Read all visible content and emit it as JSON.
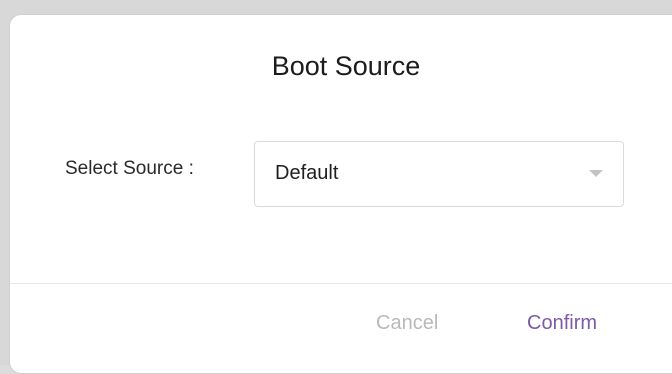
{
  "dialog": {
    "title": "Boot Source",
    "field_label": "Select Source :",
    "select": {
      "selected_value": "Default",
      "icon": "chevron-down-icon"
    },
    "buttons": {
      "cancel_label": "Cancel",
      "confirm_label": "Confirm"
    }
  },
  "colors": {
    "accent": "#7d5aa6",
    "disabled_text": "#b9b9b9"
  }
}
